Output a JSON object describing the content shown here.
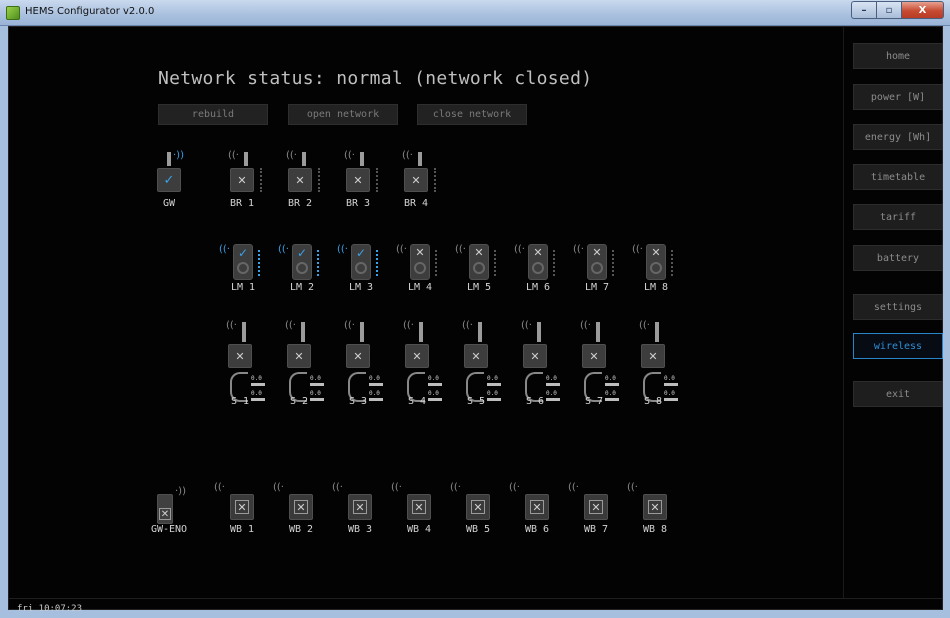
{
  "window": {
    "title": "HEMS Configurator v2.0.0",
    "min": "–",
    "max": "▫",
    "close": "X"
  },
  "network": {
    "status": "Network status: normal (network closed)"
  },
  "actions": {
    "rebuild": "rebuild",
    "open": "open network",
    "close": "close network"
  },
  "nav": {
    "home": "home",
    "power": "power [W]",
    "energy": "energy [Wh]",
    "timetable": "timetable",
    "tariff": "tariff",
    "battery": "battery",
    "settings": "settings",
    "wireless": "wireless",
    "exit": "exit"
  },
  "gateway": {
    "label": "GW",
    "status": "ok"
  },
  "bridges": [
    {
      "label": "BR 1",
      "status": "off"
    },
    {
      "label": "BR 2",
      "status": "off"
    },
    {
      "label": "BR 3",
      "status": "off"
    },
    {
      "label": "BR 4",
      "status": "off"
    }
  ],
  "load_modules": [
    {
      "label": "LM 1",
      "status": "ok"
    },
    {
      "label": "LM 2",
      "status": "ok"
    },
    {
      "label": "LM 3",
      "status": "ok"
    },
    {
      "label": "LM 4",
      "status": "off"
    },
    {
      "label": "LM 5",
      "status": "off"
    },
    {
      "label": "LM 6",
      "status": "off"
    },
    {
      "label": "LM 7",
      "status": "off"
    },
    {
      "label": "LM 8",
      "status": "off"
    }
  ],
  "sensors": [
    {
      "label": "S 1",
      "values": [
        "0.0",
        "0.0"
      ]
    },
    {
      "label": "S 2",
      "values": [
        "0.0",
        "0.0"
      ]
    },
    {
      "label": "S 3",
      "values": [
        "0.0",
        "0.0"
      ]
    },
    {
      "label": "S 4",
      "values": [
        "0.0",
        "0.0"
      ]
    },
    {
      "label": "S 5",
      "values": [
        "0.0",
        "0.0"
      ]
    },
    {
      "label": "S 6",
      "values": [
        "0.0",
        "0.0"
      ]
    },
    {
      "label": "S 7",
      "values": [
        "0.0",
        "0.0"
      ]
    },
    {
      "label": "S 8",
      "values": [
        "0.0",
        "0.0"
      ]
    }
  ],
  "gw_eno": {
    "label": "GW-ENO"
  },
  "wireless_buttons": [
    {
      "label": "WB 1"
    },
    {
      "label": "WB 2"
    },
    {
      "label": "WB 3"
    },
    {
      "label": "WB 4"
    },
    {
      "label": "WB 5"
    },
    {
      "label": "WB 6"
    },
    {
      "label": "WB 7"
    },
    {
      "label": "WB 8"
    }
  ],
  "icons": {
    "check": "✓",
    "cross": "✕",
    "wave_left": "((·",
    "wave_right": "·))"
  },
  "colors": {
    "accent": "#2e8fd8",
    "background": "#030303"
  },
  "status_bar": {
    "clock": "fri 10:07:23"
  }
}
